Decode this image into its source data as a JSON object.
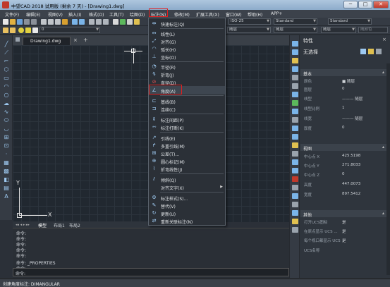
{
  "window": {
    "title": "中望CAD 2018 试用版 (剩余 7 天) - [Drawing1.dwg]",
    "minimize": "─",
    "maximize": "□",
    "close": "✕"
  },
  "menubar": {
    "items": [
      "文件(F)",
      "编辑(E)",
      "视图(V)",
      "插入(I)",
      "格式(O)",
      "工具(T)",
      "绘图(D)",
      "标注(N)",
      "修改(M)",
      "扩展工具(X)",
      "窗口(W)",
      "帮助(H)",
      "APP+"
    ]
  },
  "toolbar": {
    "layer_value": "0",
    "dim_style": "ISO-25",
    "text_style": "Standard",
    "table_style": "Standard",
    "color_bylayer": "随层",
    "linetype_bylayer": "随层",
    "lineweight_bylayer": "随层",
    "plotstyle": "随颜色"
  },
  "file_tab": {
    "name": "Drawing1.dwg",
    "close": "×",
    "new": "+"
  },
  "ucs": {
    "x": "X",
    "y": "Y"
  },
  "layout_tabs": [
    "模型",
    "布局1",
    "布局2"
  ],
  "command_history": [
    "命令:",
    "命令:",
    "命令:",
    "命令:",
    "命令:",
    "命令: _PROPERTIES",
    "命令:"
  ],
  "command_prompt": "命令:",
  "status_text": "创建角度标注:  DIMANGULAR",
  "dimension_menu": {
    "groups": [
      [
        "快速标注(Q)"
      ],
      [
        "线性(L)",
        "对齐(G)",
        "弧长(H)",
        "坐标(O)"
      ],
      [
        "半径(R)",
        "折弯(J)",
        "直径(D)",
        "角度(A)"
      ],
      [
        "基线(B)",
        "连续(C)"
      ],
      [
        "标注间距(P)",
        "标注打断(K)"
      ],
      [
        "引线(E)",
        "多重引线(M)",
        "公差(T)...",
        "圆心标记(M)",
        "折弯线性(J)"
      ],
      [
        "倾斜(Q)",
        "对齐文字(X)"
      ],
      [
        "标注样式(S)...",
        "替代(V)",
        "更新(U)",
        "重新关联标注(N)"
      ]
    ],
    "highlighted": "角度(A)"
  },
  "properties": {
    "title": "特性",
    "close": "×",
    "selection": "无选择",
    "basic": {
      "header": "基本",
      "rows": [
        [
          "颜色",
          "■ 随层"
        ],
        [
          "图层",
          "0"
        ],
        [
          "线型",
          "——— 随层"
        ],
        [
          "线型比例",
          "1"
        ],
        [
          "线宽",
          "——— 随层"
        ],
        [
          "厚度",
          "0"
        ]
      ]
    },
    "view": {
      "header": "视图",
      "rows": [
        [
          "中心点 X",
          "425.5198"
        ],
        [
          "中心点 Y",
          "271.8033"
        ],
        [
          "中心点 Z",
          "0"
        ],
        [
          "高度",
          "447.0073"
        ],
        [
          "宽度",
          "897.5412"
        ]
      ]
    },
    "misc": {
      "header": "其他",
      "rows": [
        [
          "打开UCS图标",
          "是"
        ],
        [
          "在原点显示 UCS ...",
          "是"
        ],
        [
          "每个视口都显示 UCS",
          "是"
        ],
        [
          "UCS名称",
          ""
        ]
      ]
    }
  }
}
